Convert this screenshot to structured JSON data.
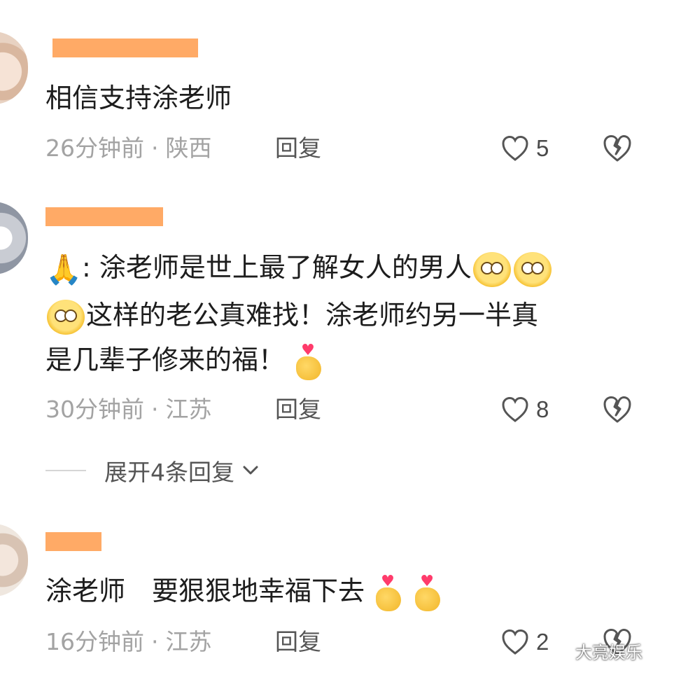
{
  "comments": [
    {
      "text": "相信支持涂老师",
      "time": "26分钟前",
      "dot": "·",
      "region": "陕西",
      "reply_label": "回复",
      "likes": "5"
    },
    {
      "lines": [
        ": 涂老师是世上最了解女人的男人",
        "这样的老公真难找！涂老师约另一半真",
        "是几辈子修来的福！"
      ],
      "time": "30分钟前",
      "dot": "·",
      "region": "江苏",
      "reply_label": "回复",
      "likes": "8",
      "expand_label": "展开4条回复"
    },
    {
      "text": "涂老师　要狠狠地幸福下去",
      "time": "16分钟前",
      "dot": "·",
      "region": "江苏",
      "reply_label": "回复",
      "likes": "2"
    }
  ],
  "emojis": {
    "pray": "🙏",
    "heart": "♥"
  },
  "watermark": "大亮娱乐",
  "colors": {
    "redaction": "#ffaa66",
    "meta_text": "#a3a3a3",
    "icon_stroke": "#555555"
  }
}
